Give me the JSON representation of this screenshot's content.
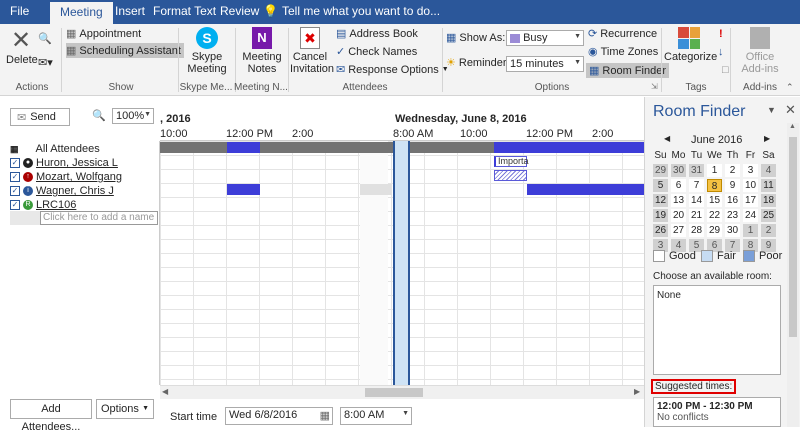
{
  "tabs": [
    {
      "label": "File"
    },
    {
      "label": "Meeting",
      "active": true
    },
    {
      "label": "Insert"
    },
    {
      "label": "Format Text"
    },
    {
      "label": "Review"
    }
  ],
  "tell_me": "Tell me what you want to do...",
  "ribbon": {
    "actions": {
      "delete": "Delete",
      "group": "Actions"
    },
    "show": {
      "appointment": "Appointment",
      "scheduling": "Scheduling Assistant",
      "group": "Show"
    },
    "skype": {
      "line1": "Skype",
      "line2": "Meeting",
      "group": "Skype Me..."
    },
    "notes": {
      "line1": "Meeting",
      "line2": "Notes",
      "group": "Meeting N..."
    },
    "attendees": {
      "cancel1": "Cancel",
      "cancel2": "Invitation",
      "address_book": "Address Book",
      "check_names": "Check Names",
      "response": "Response Options",
      "group": "Attendees"
    },
    "options": {
      "show_as": "Show As:",
      "show_as_value": "Busy",
      "reminder": "Reminder:",
      "reminder_value": "15 minutes",
      "recurrence": "Recurrence",
      "time_zones": "Time Zones",
      "room_finder": "Room Finder",
      "group": "Options"
    },
    "tags": {
      "categorize": "Categorize",
      "group": "Tags"
    },
    "addins": {
      "line1": "Office",
      "line2": "Add-ins",
      "group": "Add-ins"
    }
  },
  "toolbar": {
    "send": "Send",
    "zoom": "100%"
  },
  "dates": {
    "left": ", 2016",
    "right": "Wednesday, June 8, 2016"
  },
  "times": [
    "10:00",
    "12:00 PM",
    "2:00",
    "8:00 AM",
    "10:00",
    "12:00 PM",
    "2:00"
  ],
  "attendees_header": "All Attendees",
  "attendees": [
    {
      "name": "Huron, Jessica L",
      "role": "organizer"
    },
    {
      "name": "Mozart, Wolfgang",
      "role": "required"
    },
    {
      "name": "Wagner, Chris J",
      "role": "optional"
    },
    {
      "name": "LRC106",
      "role": "resource"
    }
  ],
  "add_name_placeholder": "Click here to add a name",
  "busy_label": "Importa",
  "bottom": {
    "add_attendees": "Add Attendees...",
    "options": "Options",
    "start_time": "Start time",
    "start_date": "Wed 6/8/2016",
    "start_clock": "8:00 AM"
  },
  "room_finder": {
    "title": "Room Finder",
    "month": "June 2016",
    "weekdays": [
      "Su",
      "Mo",
      "Tu",
      "We",
      "Th",
      "Fr",
      "Sa"
    ],
    "weeks": [
      [
        "29",
        "30",
        "31",
        "1",
        "2",
        "3",
        "4"
      ],
      [
        "5",
        "6",
        "7",
        "8",
        "9",
        "10",
        "11"
      ],
      [
        "12",
        "13",
        "14",
        "15",
        "16",
        "17",
        "18"
      ],
      [
        "19",
        "20",
        "21",
        "22",
        "23",
        "24",
        "25"
      ],
      [
        "26",
        "27",
        "28",
        "29",
        "30",
        "1",
        "2"
      ],
      [
        "3",
        "4",
        "5",
        "6",
        "7",
        "8",
        "9"
      ]
    ],
    "selected_day": "8",
    "legend": {
      "good": "Good",
      "fair": "Fair",
      "poor": "Poor"
    },
    "choose_room": "Choose an available room:",
    "room_value": "None",
    "suggested": "Suggested times:",
    "suggestion_time": "12:00 PM - 12:30 PM",
    "suggestion_status": "No conflicts"
  },
  "colors": {
    "accent": "#2b579a",
    "busy": "#3d3dd8",
    "highlight": "#e00000"
  }
}
